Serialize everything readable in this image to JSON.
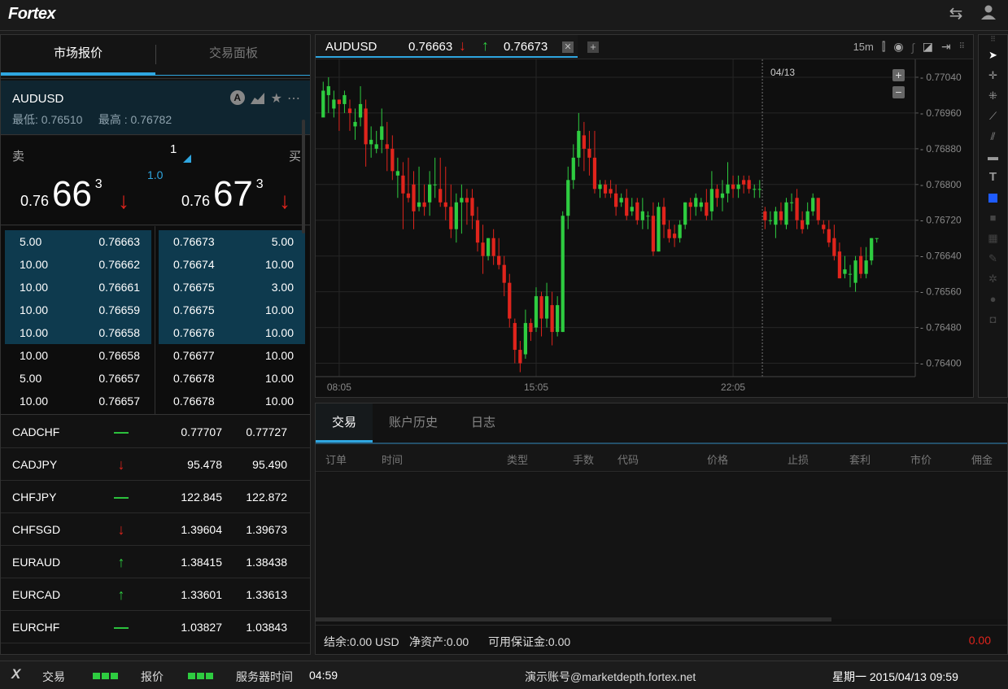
{
  "app": {
    "logo": "Fortex"
  },
  "left_panel": {
    "tabs": [
      {
        "label": "市场报价"
      },
      {
        "label": "交易面板"
      }
    ],
    "symbol": {
      "name": "AUDUSD",
      "low": "最低: 0.76510",
      "high": "最高 : 0.76782"
    },
    "quote": {
      "sell_label": "卖",
      "buy_label": "买",
      "quantity": "1",
      "spread": "1.0",
      "sell": {
        "prefix": "0.76",
        "big": "66",
        "sup": "3"
      },
      "buy": {
        "prefix": "0.76",
        "big": "67",
        "sup": "3"
      }
    },
    "depth_bids": [
      [
        "5.00",
        "0.76663"
      ],
      [
        "10.00",
        "0.76662"
      ],
      [
        "10.00",
        "0.76661"
      ],
      [
        "10.00",
        "0.76659"
      ],
      [
        "10.00",
        "0.76658"
      ],
      [
        "10.00",
        "0.76658"
      ],
      [
        "5.00",
        "0.76657"
      ],
      [
        "10.00",
        "0.76657"
      ]
    ],
    "depth_asks": [
      [
        "0.76673",
        "5.00"
      ],
      [
        "0.76674",
        "10.00"
      ],
      [
        "0.76675",
        "3.00"
      ],
      [
        "0.76675",
        "10.00"
      ],
      [
        "0.76676",
        "10.00"
      ],
      [
        "0.76677",
        "10.00"
      ],
      [
        "0.76678",
        "10.00"
      ],
      [
        "0.76678",
        "10.00"
      ]
    ],
    "watchlist": [
      {
        "symbol": "CADCHF",
        "dir": "flat",
        "bid": "0.77707",
        "ask": "0.77727"
      },
      {
        "symbol": "CADJPY",
        "dir": "down",
        "bid": "95.478",
        "ask": "95.490"
      },
      {
        "symbol": "CHFJPY",
        "dir": "flat",
        "bid": "122.845",
        "ask": "122.872"
      },
      {
        "symbol": "CHFSGD",
        "dir": "down",
        "bid": "1.39604",
        "ask": "1.39673"
      },
      {
        "symbol": "EURAUD",
        "dir": "up",
        "bid": "1.38415",
        "ask": "1.38438"
      },
      {
        "symbol": "EURCAD",
        "dir": "up",
        "bid": "1.33601",
        "ask": "1.33613"
      },
      {
        "symbol": "EURCHF",
        "dir": "flat",
        "bid": "1.03827",
        "ask": "1.03843"
      }
    ]
  },
  "chart_panel": {
    "tab": {
      "symbol": "AUDUSD",
      "bid": "0.76663",
      "ask": "0.76673"
    },
    "timeframe": "15m",
    "date_marker": "04/13",
    "colors": {
      "up": "#2ecc40",
      "down": "#e0241c"
    },
    "x_ticks": [
      "08:05",
      "15:05",
      "22:05"
    ],
    "y_ticks": [
      "0.77040",
      "0.76960",
      "0.76880",
      "0.76800",
      "0.76720",
      "0.76640",
      "0.76560",
      "0.76480",
      "0.76400"
    ]
  },
  "chart_data": {
    "type": "candlestick",
    "ylim": [
      0.7637,
      0.7708
    ],
    "candles": [
      [
        0.7695,
        0.7701,
        0.7697,
        0.7703
      ],
      [
        0.77,
        0.7702,
        0.7696,
        0.7704
      ],
      [
        0.7697,
        0.7699,
        0.7695,
        0.7701
      ],
      [
        0.7699,
        0.7698,
        0.7692,
        0.7699
      ],
      [
        0.7698,
        0.77,
        0.7696,
        0.7701
      ],
      [
        0.7697,
        0.7696,
        0.7692,
        0.7699
      ],
      [
        0.7693,
        0.7694,
        0.769,
        0.7697
      ],
      [
        0.7695,
        0.7698,
        0.7693,
        0.7702
      ],
      [
        0.7697,
        0.7689,
        0.7684,
        0.7699
      ],
      [
        0.7689,
        0.769,
        0.7686,
        0.7693
      ],
      [
        0.7688,
        0.7689,
        0.7687,
        0.7692
      ],
      [
        0.769,
        0.7693,
        0.7687,
        0.7697
      ],
      [
        0.7689,
        0.7688,
        0.7683,
        0.7694
      ],
      [
        0.7688,
        0.7683,
        0.7681,
        0.7691
      ],
      [
        0.7682,
        0.7683,
        0.7677,
        0.7686
      ],
      [
        0.7682,
        0.7678,
        0.767,
        0.7685
      ],
      [
        0.7678,
        0.7677,
        0.7676,
        0.7686
      ],
      [
        0.768,
        0.7674,
        0.767,
        0.7683
      ],
      [
        0.7675,
        0.7676,
        0.7674,
        0.7684
      ],
      [
        0.7676,
        0.7675,
        0.7673,
        0.768
      ],
      [
        0.7676,
        0.768,
        0.7673,
        0.7683
      ],
      [
        0.768,
        0.768,
        0.7677,
        0.7686
      ],
      [
        0.7679,
        0.7676,
        0.7675,
        0.7686
      ],
      [
        0.7676,
        0.7675,
        0.7672,
        0.7684
      ],
      [
        0.7675,
        0.767,
        0.7668,
        0.768
      ],
      [
        0.767,
        0.7676,
        0.7667,
        0.7678
      ],
      [
        0.7676,
        0.7677,
        0.7669,
        0.768
      ],
      [
        0.7677,
        0.7676,
        0.7671,
        0.7679
      ],
      [
        0.7677,
        0.7673,
        0.767,
        0.7679
      ],
      [
        0.7672,
        0.7667,
        0.7665,
        0.7675
      ],
      [
        0.7667,
        0.7664,
        0.766,
        0.7671
      ],
      [
        0.7664,
        0.7668,
        0.7663,
        0.7668
      ],
      [
        0.7668,
        0.7664,
        0.7662,
        0.767
      ],
      [
        0.7664,
        0.7662,
        0.7661,
        0.7668
      ],
      [
        0.7662,
        0.7658,
        0.7655,
        0.7664
      ],
      [
        0.7658,
        0.765,
        0.7648,
        0.766
      ],
      [
        0.7649,
        0.7643,
        0.764,
        0.765
      ],
      [
        0.7643,
        0.764,
        0.7638,
        0.7645
      ],
      [
        0.7642,
        0.7649,
        0.7641,
        0.7652
      ],
      [
        0.7649,
        0.7647,
        0.7645,
        0.765
      ],
      [
        0.7648,
        0.7655,
        0.7647,
        0.7657
      ],
      [
        0.7655,
        0.765,
        0.7646,
        0.7656
      ],
      [
        0.765,
        0.7655,
        0.7648,
        0.7658
      ],
      [
        0.7653,
        0.7647,
        0.7644,
        0.7656
      ],
      [
        0.7647,
        0.7653,
        0.7646,
        0.7655
      ],
      [
        0.7647,
        0.7673,
        0.7647,
        0.7674
      ],
      [
        0.7673,
        0.7681,
        0.767,
        0.7684
      ],
      [
        0.7681,
        0.7686,
        0.7679,
        0.7689
      ],
      [
        0.7686,
        0.7692,
        0.7684,
        0.7696
      ],
      [
        0.7691,
        0.7688,
        0.7683,
        0.7694
      ],
      [
        0.7688,
        0.7686,
        0.7682,
        0.7692
      ],
      [
        0.7686,
        0.7679,
        0.7678,
        0.7692
      ],
      [
        0.7679,
        0.768,
        0.7677,
        0.7681
      ],
      [
        0.768,
        0.7678,
        0.7677,
        0.7681
      ],
      [
        0.7679,
        0.7678,
        0.7677,
        0.7681
      ],
      [
        0.7678,
        0.7675,
        0.7673,
        0.768
      ],
      [
        0.7676,
        0.7677,
        0.7675,
        0.7678
      ],
      [
        0.7677,
        0.7673,
        0.7672,
        0.7679
      ],
      [
        0.7674,
        0.7675,
        0.7673,
        0.7677
      ],
      [
        0.7676,
        0.7672,
        0.7671,
        0.7677
      ],
      [
        0.7672,
        0.7674,
        0.767,
        0.7677
      ],
      [
        0.7673,
        0.7673,
        0.767,
        0.7674
      ],
      [
        0.7673,
        0.7665,
        0.7664,
        0.7676
      ],
      [
        0.7665,
        0.7675,
        0.7665,
        0.7676
      ],
      [
        0.7675,
        0.7671,
        0.7668,
        0.7677
      ],
      [
        0.767,
        0.7668,
        0.7667,
        0.7672
      ],
      [
        0.7669,
        0.7668,
        0.7666,
        0.7671
      ],
      [
        0.7668,
        0.7671,
        0.7667,
        0.7672
      ],
      [
        0.7671,
        0.7676,
        0.767,
        0.7676
      ],
      [
        0.7676,
        0.7675,
        0.7672,
        0.7677
      ],
      [
        0.7675,
        0.7677,
        0.7673,
        0.7678
      ],
      [
        0.7675,
        0.7676,
        0.7674,
        0.7677
      ],
      [
        0.7676,
        0.7673,
        0.7672,
        0.7679
      ],
      [
        0.7674,
        0.7679,
        0.7672,
        0.7683
      ],
      [
        0.7679,
        0.7677,
        0.7675,
        0.768
      ],
      [
        0.7677,
        0.7678,
        0.7674,
        0.7681
      ],
      [
        0.7678,
        0.768,
        0.7676,
        0.7685
      ],
      [
        0.768,
        0.7679,
        0.7677,
        0.7682
      ],
      [
        0.7679,
        0.768,
        0.7677,
        0.7682
      ],
      [
        0.7681,
        0.768,
        0.7678,
        0.7682
      ],
      [
        0.7681,
        0.7679,
        0.7678,
        0.7682
      ],
      [
        0.7679,
        0.7679,
        0.7677,
        0.768
      ],
      [
        0.7679,
        0.7679,
        0.7677,
        0.7681
      ],
      [
        0.7674,
        0.7672,
        0.767,
        0.7675
      ],
      [
        0.7672,
        0.7672,
        0.7671,
        0.7674
      ],
      [
        0.7671,
        0.7674,
        0.7668,
        0.7675
      ],
      [
        0.7674,
        0.7672,
        0.7671,
        0.7676
      ],
      [
        0.7671,
        0.7676,
        0.767,
        0.7677
      ],
      [
        0.7676,
        0.7676,
        0.7674,
        0.7678
      ],
      [
        0.7677,
        0.7672,
        0.767,
        0.7679
      ],
      [
        0.7672,
        0.767,
        0.7669,
        0.7674
      ],
      [
        0.7671,
        0.7674,
        0.767,
        0.7676
      ],
      [
        0.7674,
        0.7677,
        0.7673,
        0.7678
      ],
      [
        0.7677,
        0.7672,
        0.7671,
        0.7677
      ],
      [
        0.7671,
        0.767,
        0.7669,
        0.7672
      ],
      [
        0.767,
        0.7667,
        0.7666,
        0.7672
      ],
      [
        0.7668,
        0.7664,
        0.7663,
        0.7671
      ],
      [
        0.7665,
        0.7659,
        0.7659,
        0.7667
      ],
      [
        0.766,
        0.7661,
        0.7659,
        0.7664
      ],
      [
        0.766,
        0.766,
        0.7657,
        0.7662
      ],
      [
        0.7658,
        0.7663,
        0.7656,
        0.7664
      ],
      [
        0.7664,
        0.766,
        0.7659,
        0.7666
      ],
      [
        0.766,
        0.7663,
        0.7659,
        0.7666
      ],
      [
        0.7663,
        0.7668,
        0.7662,
        0.7668
      ],
      [
        0.7668,
        0.7668,
        0.7667,
        0.7668
      ]
    ]
  },
  "orders_panel": {
    "tabs": [
      "交易",
      "账户历史",
      "日志"
    ],
    "columns": [
      "订单",
      "时间",
      "类型",
      "手数",
      "代码",
      "价格",
      "止损",
      "套利",
      "市价",
      "佣金"
    ],
    "footer": {
      "balance": "结余:0.00 USD",
      "equity": "净资产:0.00",
      "margin": "可用保证金:0.00",
      "pnl": "0.00"
    }
  },
  "status_bar": {
    "trade_label": "交易",
    "quote_label": "报价",
    "server_time_label": "服务器时间",
    "server_time": "04:59",
    "account": "演示账号@marketdepth.fortex.net",
    "datetime": "星期一 2015/04/13 09:59"
  }
}
